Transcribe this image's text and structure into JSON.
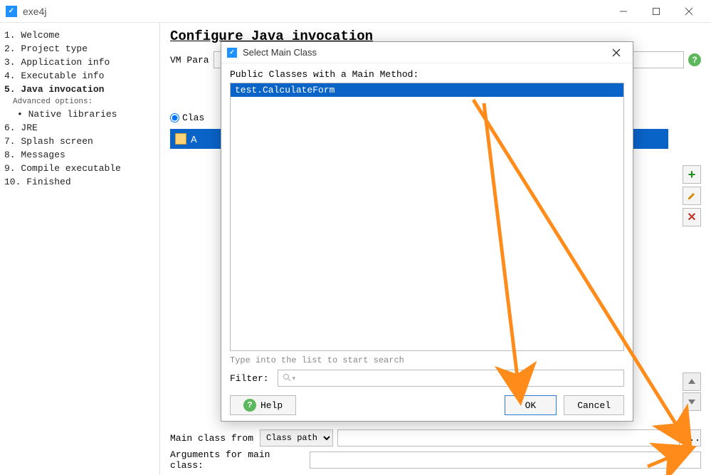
{
  "app": {
    "title": "exe4j"
  },
  "sidebar": {
    "items": [
      {
        "num": "1.",
        "label": "Welcome"
      },
      {
        "num": "2.",
        "label": "Project type"
      },
      {
        "num": "3.",
        "label": "Application info"
      },
      {
        "num": "4.",
        "label": "Executable info"
      },
      {
        "num": "5.",
        "label": "Java invocation",
        "bold": true
      },
      {
        "num": "6.",
        "label": "JRE"
      },
      {
        "num": "7.",
        "label": "Splash screen"
      },
      {
        "num": "8.",
        "label": "Messages"
      },
      {
        "num": "9.",
        "label": "Compile executable"
      },
      {
        "num": "10.",
        "label": "Finished"
      }
    ],
    "advanced_label": "Advanced options:",
    "advanced_item": "Native libraries"
  },
  "page": {
    "title": "Configure Java invocation",
    "vm_params_label": "VM Para",
    "vm_params_value": "",
    "classpath_radio_label": "Clas",
    "list_item_label": "A",
    "main_class_label": "Main class from",
    "main_class_combo": "Class path",
    "main_class_value": "",
    "args_label": "Arguments for main class:",
    "args_value": ""
  },
  "dialog": {
    "title": "Select Main Class",
    "list_label": "Public Classes with a Main Method:",
    "selected_class": "test.CalculateForm",
    "hint": "Type into the list to start search",
    "filter_label": "Filter:",
    "filter_value": "",
    "help_label": "Help",
    "ok_label": "OK",
    "cancel_label": "Cancel"
  },
  "buttons": {
    "browse": "..."
  }
}
